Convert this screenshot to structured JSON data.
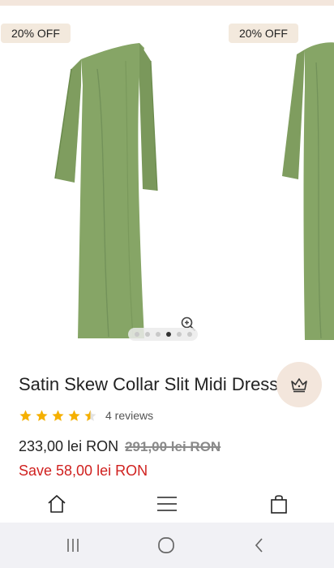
{
  "gallery": {
    "slides": [
      {
        "badge": "20% OFF",
        "alt": "green dress front"
      },
      {
        "badge": "20% OFF",
        "alt": "green dress side"
      }
    ],
    "dot_count": 6,
    "active_dot": 3
  },
  "product": {
    "title": "Satin Skew Collar Slit Midi Dress",
    "rating": 4.5,
    "reviews_label": "4 reviews",
    "price": "233,00 lei RON",
    "old_price": "291,00 lei RON",
    "save_label": "Save 58,00 lei RON"
  },
  "colors": {
    "dress_green": "#7f9d5f",
    "star": "#f5b000",
    "sale_red": "#d0211f",
    "badge_bg": "#f3e9dd",
    "accent_peach": "#f3e6dc"
  },
  "icons": {
    "zoom": "zoom-in-icon",
    "crown": "crown-icon",
    "home": "home-icon",
    "menu": "menu-icon",
    "bag": "bag-icon",
    "recents": "recents-icon",
    "home_sys": "home-circle-icon",
    "back": "back-icon"
  }
}
